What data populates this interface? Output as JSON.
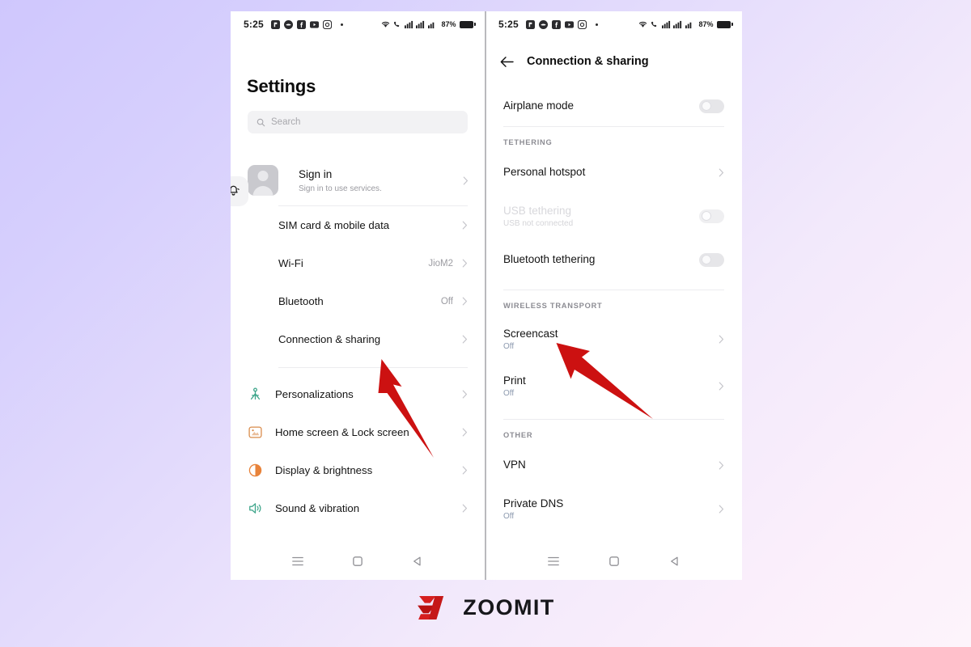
{
  "background": {
    "from": "#cfc7fd",
    "to": "#fdf4fb"
  },
  "accent": {
    "red": "#cc1111",
    "link": "#8d9aaf",
    "muted": "#9c9ca2"
  },
  "status_bar": {
    "time": "5:25",
    "battery_percent": "87%",
    "notification_icons": [
      "app-icon",
      "app-icon",
      "facebook-icon",
      "youtube-icon",
      "instagram-icon"
    ],
    "signal_icons": [
      "wifi-icon",
      "call-icon",
      "signal-bars-icon",
      "signal-bars-icon",
      "signal-bars-icon"
    ]
  },
  "left_phone": {
    "page_title": "Settings",
    "search": {
      "placeholder": "Search",
      "icon": "search-icon"
    },
    "account": {
      "title": "Sign in",
      "subtitle": "Sign in to use services.",
      "avatar_icon": "avatar-person-icon",
      "badge_icon": "bell-icon",
      "chevron": "chevron-right-icon"
    },
    "group_connectivity": [
      {
        "label": "SIM card & mobile data",
        "value": "",
        "icon": ""
      },
      {
        "label": "Wi-Fi",
        "value": "JioM2",
        "icon": ""
      },
      {
        "label": "Bluetooth",
        "value": "Off",
        "icon": ""
      },
      {
        "label": "Connection & sharing",
        "value": "",
        "icon": ""
      }
    ],
    "group_system": [
      {
        "label": "Personalizations",
        "value": "",
        "icon": "personalization-icon",
        "icon_color": "#3da58a"
      },
      {
        "label": "Home screen & Lock screen",
        "value": "",
        "icon": "home-lock-screen-icon",
        "icon_color": "#d98b4a"
      },
      {
        "label": "Display & brightness",
        "value": "",
        "icon": "display-brightness-icon",
        "icon_color": "#e8833a"
      },
      {
        "label": "Sound & vibration",
        "value": "",
        "icon": "sound-vibration-icon",
        "icon_color": "#3da58a"
      }
    ]
  },
  "right_phone": {
    "back_icon": "arrow-left-icon",
    "page_title": "Connection & sharing",
    "airplane": {
      "label": "Airplane mode",
      "toggle_state": "off"
    },
    "sections": [
      {
        "header": "TETHERING",
        "items": [
          {
            "label": "Personal hotspot",
            "sub": "",
            "control": "chevron",
            "disabled": false
          },
          {
            "label": "USB tethering",
            "sub": "USB not connected",
            "control": "toggle",
            "toggle_state": "off",
            "disabled": true
          },
          {
            "label": "Bluetooth tethering",
            "sub": "",
            "control": "toggle",
            "toggle_state": "off",
            "disabled": false
          }
        ]
      },
      {
        "header": "WIRELESS TRANSPORT",
        "items": [
          {
            "label": "Screencast",
            "sub": "Off",
            "control": "chevron",
            "disabled": false
          },
          {
            "label": "Print",
            "sub": "Off",
            "control": "chevron",
            "disabled": false
          }
        ]
      },
      {
        "header": "OTHER",
        "items": [
          {
            "label": "VPN",
            "sub": "",
            "control": "chevron",
            "disabled": false
          },
          {
            "label": "Private DNS",
            "sub": "Off",
            "control": "chevron",
            "disabled": false
          }
        ]
      }
    ]
  },
  "nav_bar": {
    "recents_icon": "recents-menu-icon",
    "home_icon": "home-square-icon",
    "back_icon": "back-triangle-icon"
  },
  "annotations": [
    {
      "name": "arrow-to-connection-sharing",
      "color": "#cc1111"
    },
    {
      "name": "arrow-to-screencast",
      "color": "#cc1111"
    }
  ],
  "watermark": {
    "text": "ZOOMIT",
    "mark": "Z",
    "mark_color": "#d61f1f"
  }
}
